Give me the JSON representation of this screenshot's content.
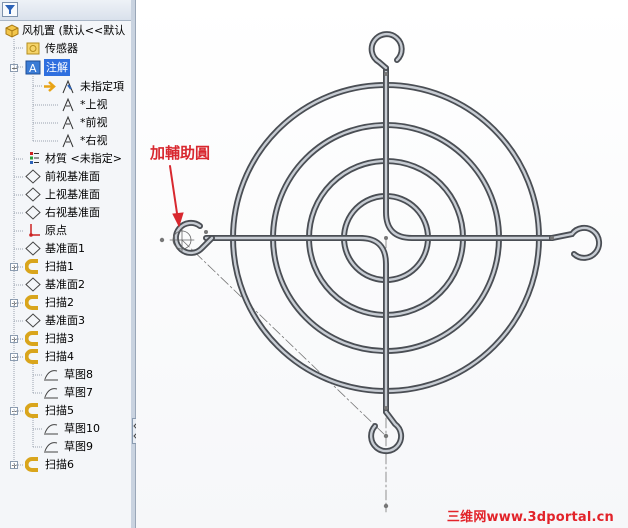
{
  "feature_tree": {
    "root": "风机置 (默认<<默认",
    "items": [
      {
        "label": "传感器",
        "icon": "sensor-icon"
      },
      {
        "label": "注解",
        "icon": "annotation-icon",
        "selected": true
      },
      {
        "label": "未指定項",
        "icon": "annotation-view-icon"
      },
      {
        "label": "*上视",
        "icon": "annotation-view-icon"
      },
      {
        "label": "*前视",
        "icon": "annotation-view-icon"
      },
      {
        "label": "*右视",
        "icon": "annotation-view-icon"
      },
      {
        "label": "材質 <未指定>",
        "icon": "material-icon"
      },
      {
        "label": "前视基准面",
        "icon": "plane-icon"
      },
      {
        "label": "上视基准面",
        "icon": "plane-icon"
      },
      {
        "label": "右视基准面",
        "icon": "plane-icon"
      },
      {
        "label": "原点",
        "icon": "origin-icon"
      },
      {
        "label": "基准面1",
        "icon": "plane-icon"
      },
      {
        "label": "扫描1",
        "icon": "sweep-icon"
      },
      {
        "label": "基准面2",
        "icon": "plane-icon"
      },
      {
        "label": "扫描2",
        "icon": "sweep-icon"
      },
      {
        "label": "基准面3",
        "icon": "plane-icon"
      },
      {
        "label": "扫描3",
        "icon": "sweep-icon"
      },
      {
        "label": "扫描4",
        "icon": "sweep-icon"
      },
      {
        "label": "草图8",
        "icon": "sketch-icon"
      },
      {
        "label": "草图7",
        "icon": "sketch-icon"
      },
      {
        "label": "扫描5",
        "icon": "sweep-icon"
      },
      {
        "label": "草图10",
        "icon": "sketch-icon"
      },
      {
        "label": "草图9",
        "icon": "sketch-icon"
      },
      {
        "label": "扫描6",
        "icon": "sweep-icon"
      }
    ]
  },
  "viewport": {
    "annotation_label": "加輔助圓",
    "watermark": "三维网www.3dportal.cn"
  },
  "colors": {
    "annotation": "#d8282f",
    "selection": "#2f6fdf",
    "wire": "#9aa0a8"
  }
}
